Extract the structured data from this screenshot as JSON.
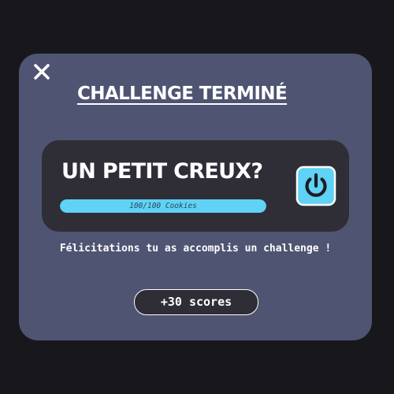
{
  "modal": {
    "title": "CHALLENGE TERMINÉ",
    "close_icon": "close-icon"
  },
  "challenge": {
    "name": "UN PETIT CREUX?",
    "progress_label": "100/100 Cookies",
    "progress_fraction": 1.0,
    "power_icon": "power-icon"
  },
  "message": "Félicitations tu as accomplis un challenge !",
  "reward": {
    "label": "+30 scores"
  },
  "colors": {
    "page_background": "#18171c",
    "modal_background": "#4f5472",
    "card_background": "#2f2e37",
    "accent": "#5fd2f5",
    "text": "#ffffff"
  }
}
